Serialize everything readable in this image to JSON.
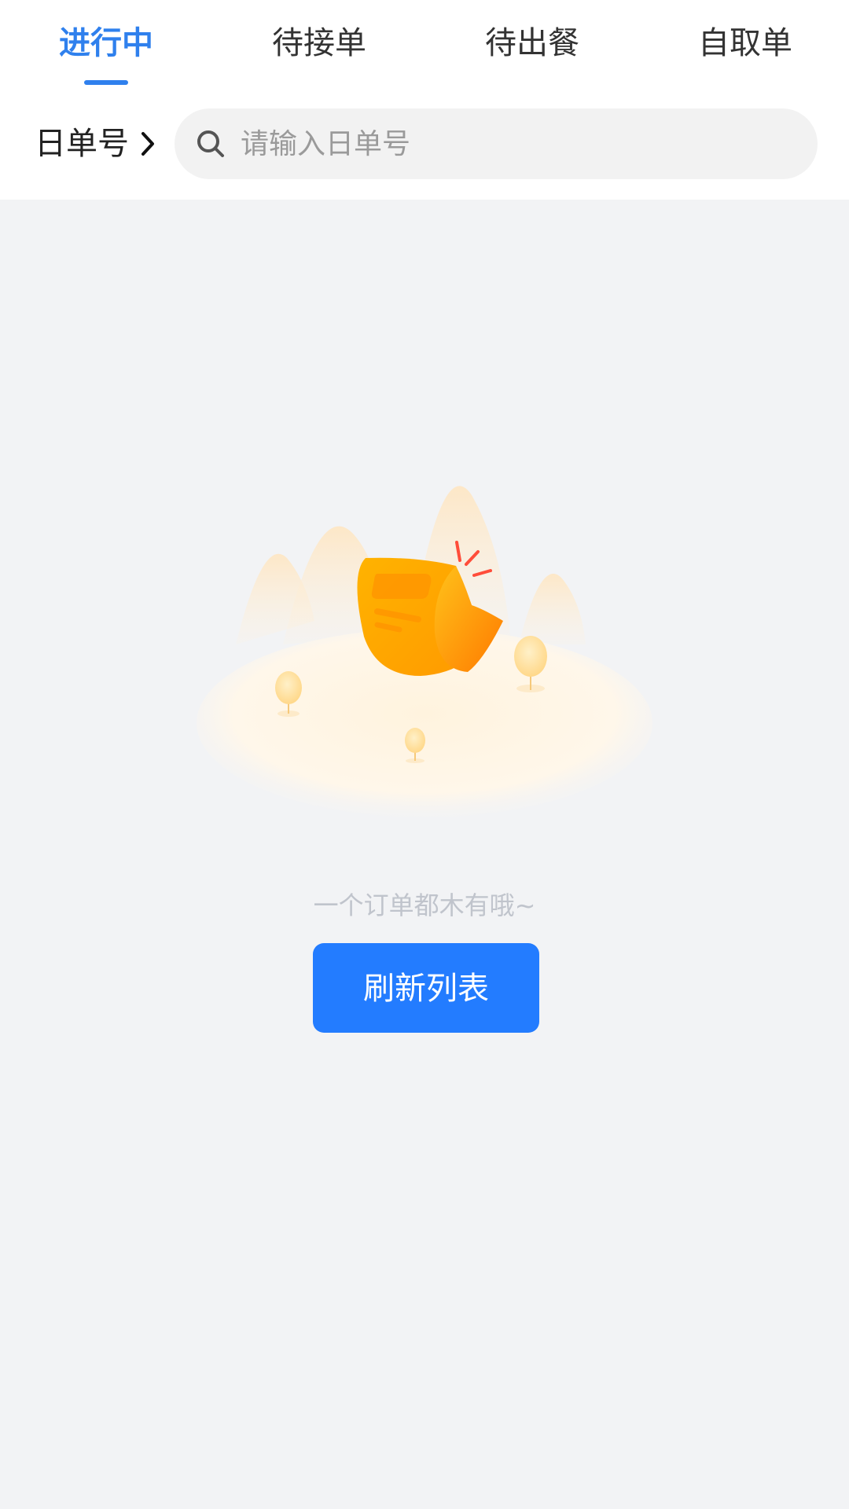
{
  "tabs": [
    {
      "label": "进行中",
      "active": true
    },
    {
      "label": "待接单",
      "active": false
    },
    {
      "label": "待出餐",
      "active": false
    },
    {
      "label": "自取单",
      "active": false
    }
  ],
  "filter": {
    "order_type_label": "日单号"
  },
  "search": {
    "placeholder": "请输入日单号",
    "value": ""
  },
  "empty_state": {
    "illustration": "empty-order-illustration",
    "message": "一个订单都木有哦~",
    "button_label": "刷新列表"
  },
  "colors": {
    "accent": "#2f80ed",
    "button": "#237cff",
    "background": "#f2f3f5"
  }
}
